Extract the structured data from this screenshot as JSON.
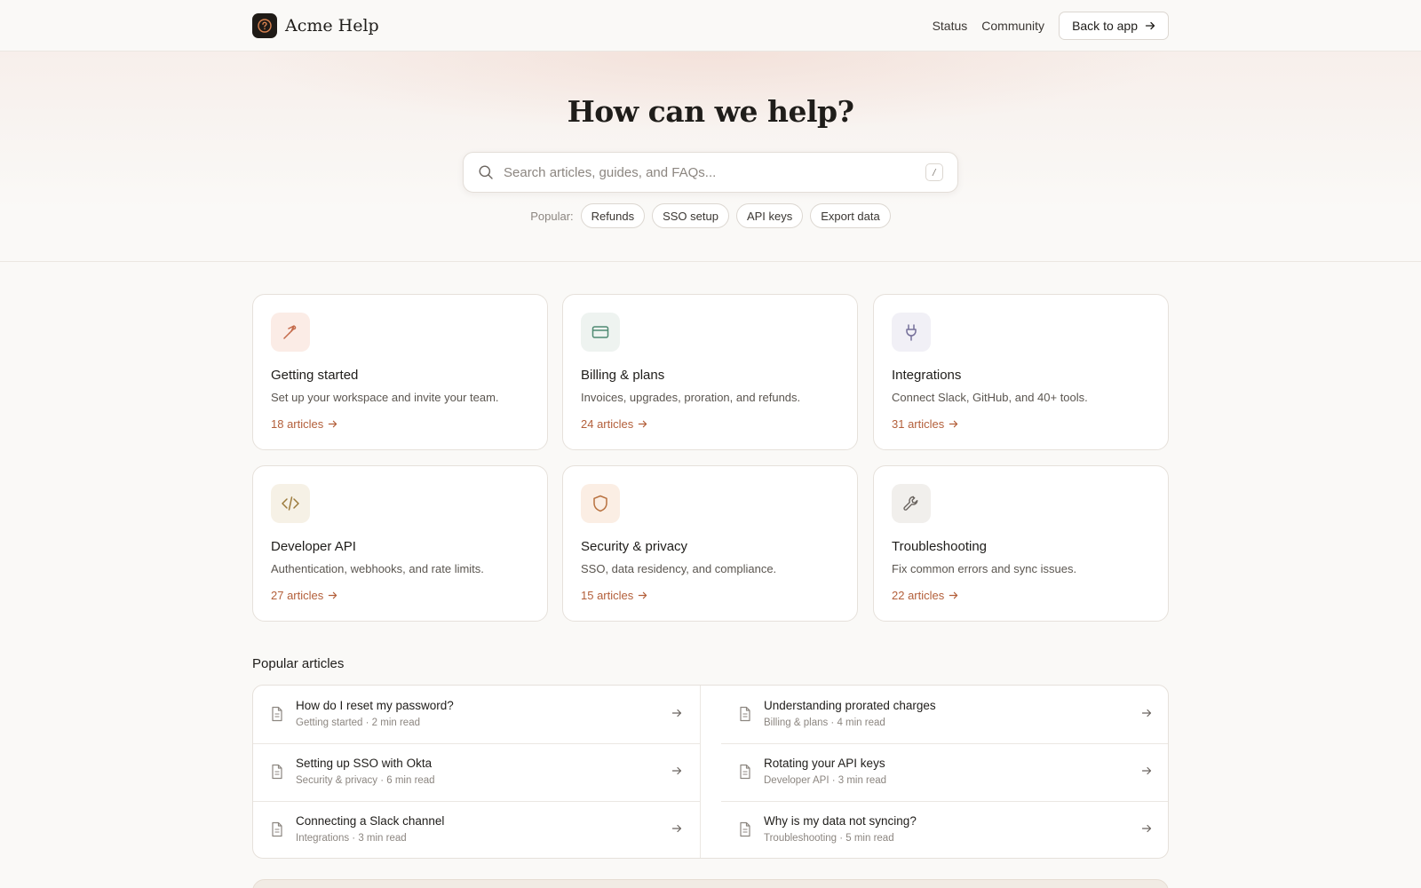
{
  "brand": {
    "name": "Acme Help"
  },
  "nav": {
    "status": "Status",
    "community": "Community",
    "back_to_app": "Back to app"
  },
  "hero": {
    "title": "How can we help?",
    "search_placeholder": "Search articles, guides, and FAQs...",
    "search_shortcut": "/",
    "popular_label": "Popular:",
    "popular_chips": [
      "Refunds",
      "SSO setup",
      "API keys",
      "Export data"
    ]
  },
  "categories": [
    {
      "title": "Getting started",
      "description": "Set up your workspace and invite your team.",
      "count": "18 articles",
      "icon": "rocket-icon",
      "color": "#c46a4a",
      "bg": "#fbece6"
    },
    {
      "title": "Billing & plans",
      "description": "Invoices, upgrades, proration, and refunds.",
      "count": "24 articles",
      "icon": "credit-card-icon",
      "color": "#4f8a72",
      "bg": "#eef3f0"
    },
    {
      "title": "Integrations",
      "description": "Connect Slack, GitHub, and 40+ tools.",
      "count": "31 articles",
      "icon": "plug-icon",
      "color": "#76709a",
      "bg": "#f1f0f6"
    },
    {
      "title": "Developer API",
      "description": "Authentication, webhooks, and rate limits.",
      "count": "27 articles",
      "icon": "code-icon",
      "color": "#9c7a3c",
      "bg": "#f6f1e6"
    },
    {
      "title": "Security & privacy",
      "description": "SSO, data residency, and compliance.",
      "count": "15 articles",
      "icon": "shield-icon",
      "color": "#b8713f",
      "bg": "#fbeee4"
    },
    {
      "title": "Troubleshooting",
      "description": "Fix common errors and sync issues.",
      "count": "22 articles",
      "icon": "wrench-icon",
      "color": "#6b6560",
      "bg": "#f1efec"
    }
  ],
  "popular_articles": {
    "heading": "Popular articles",
    "items": [
      {
        "title": "How do I reset my password?",
        "meta": "Getting started · 2 min read"
      },
      {
        "title": "Understanding prorated charges",
        "meta": "Billing & plans · 4 min read"
      },
      {
        "title": "Setting up SSO with Okta",
        "meta": "Security & privacy · 6 min read"
      },
      {
        "title": "Rotating your API keys",
        "meta": "Developer API · 3 min read"
      },
      {
        "title": "Connecting a Slack channel",
        "meta": "Integrations · 3 min read"
      },
      {
        "title": "Why is my data not syncing?",
        "meta": "Troubleshooting · 5 min read"
      }
    ]
  },
  "colors": {
    "accent": "#b35f3a",
    "border": "#e6e1db",
    "background": "#faf9f7"
  }
}
